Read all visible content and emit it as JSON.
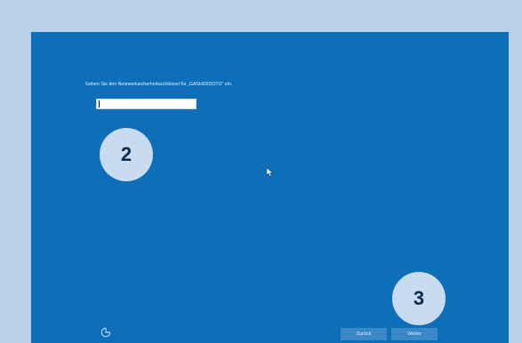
{
  "setup": {
    "prompt_text": "Geben Sie den Netzwerksicherheitsschlüssel für „GASHD5DOTO“ ein.",
    "key_input_value": "",
    "back_label": "Zurück",
    "next_label": "Weiter"
  },
  "annotations": {
    "step_2": "2",
    "step_3": "3"
  },
  "icons": {
    "accessibility": "ease-of-access-icon",
    "cursor": "mouse-pointer-icon"
  },
  "colors": {
    "screen_background": "#0d6fb8",
    "frame_background": "#b9d1e8",
    "badge_background": "#c8dbef",
    "button_background": "#3a88c8"
  }
}
